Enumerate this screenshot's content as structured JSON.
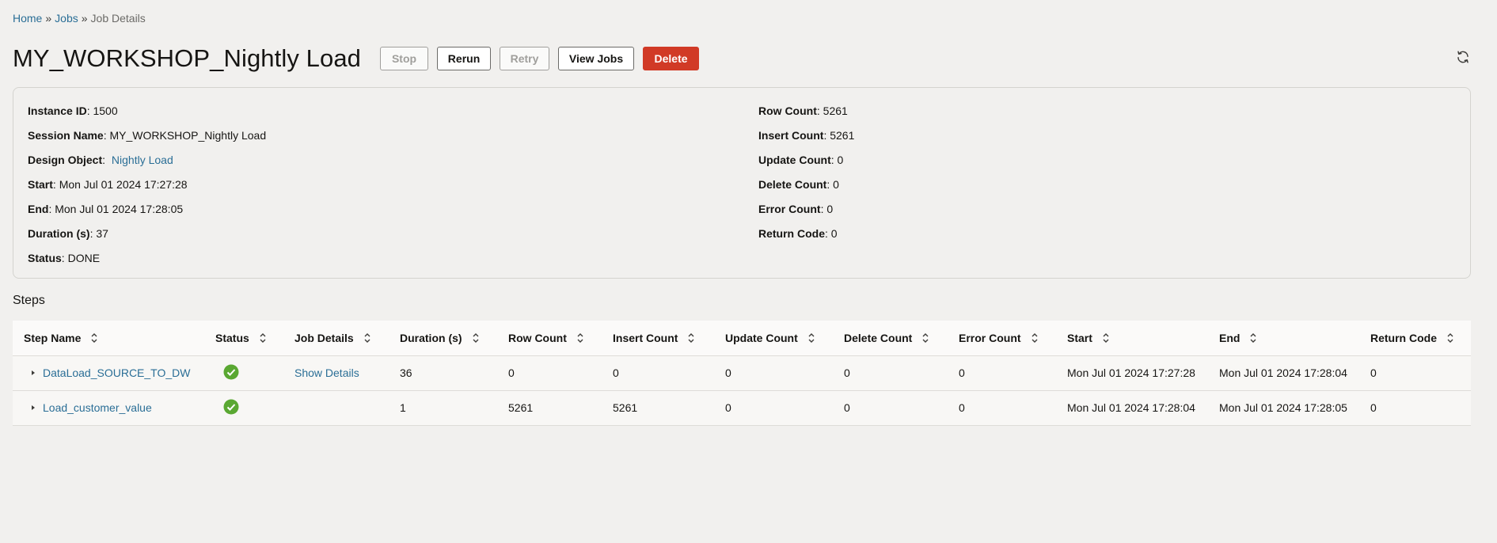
{
  "breadcrumb": {
    "home": "Home",
    "sep1": "»",
    "jobs": "Jobs",
    "sep2": "»",
    "current": "Job Details"
  },
  "title": "MY_WORKSHOP_Nightly Load",
  "toolbar": {
    "stop": "Stop",
    "rerun": "Rerun",
    "retry": "Retry",
    "view_jobs": "View Jobs",
    "delete": "Delete"
  },
  "details": {
    "instance_id": {
      "label": "Instance ID",
      "value": "1500"
    },
    "session_name": {
      "label": "Session Name",
      "value": "MY_WORKSHOP_Nightly Load"
    },
    "design_object": {
      "label": "Design Object",
      "value": "Nightly Load"
    },
    "start": {
      "label": "Start",
      "value": "Mon Jul 01 2024 17:27:28"
    },
    "end": {
      "label": "End",
      "value": "Mon Jul 01 2024 17:28:05"
    },
    "duration": {
      "label": "Duration (s)",
      "value": "37"
    },
    "status": {
      "label": "Status",
      "value": "DONE"
    },
    "row_count": {
      "label": "Row Count",
      "value": "5261"
    },
    "insert_count": {
      "label": "Insert Count",
      "value": "5261"
    },
    "update_count": {
      "label": "Update Count",
      "value": "0"
    },
    "delete_count": {
      "label": "Delete Count",
      "value": "0"
    },
    "error_count": {
      "label": "Error Count",
      "value": "0"
    },
    "return_code": {
      "label": "Return Code",
      "value": "0"
    }
  },
  "steps": {
    "heading": "Steps",
    "columns": [
      "Step Name",
      "Status",
      "Job Details",
      "Duration (s)",
      "Row Count",
      "Insert Count",
      "Update Count",
      "Delete Count",
      "Error Count",
      "Start",
      "End",
      "Return Code"
    ],
    "rows": [
      {
        "step_name": "DataLoad_SOURCE_TO_DW",
        "status": "success",
        "job_details": "Show Details",
        "duration": "36",
        "row_count": "0",
        "insert_count": "0",
        "update_count": "0",
        "delete_count": "0",
        "error_count": "0",
        "start": "Mon Jul 01 2024 17:27:28",
        "end": "Mon Jul 01 2024 17:28:04",
        "return_code": "0"
      },
      {
        "step_name": "Load_customer_value",
        "status": "success",
        "job_details": "",
        "duration": "1",
        "row_count": "5261",
        "insert_count": "5261",
        "update_count": "0",
        "delete_count": "0",
        "error_count": "0",
        "start": "Mon Jul 01 2024 17:28:04",
        "end": "Mon Jul 01 2024 17:28:05",
        "return_code": "0"
      }
    ]
  },
  "colors": {
    "link": "#2a6e96",
    "danger": "#d13a26",
    "success": "#5aa832"
  },
  "icons": {
    "refresh": "refresh-icon",
    "sort": "sort-icon",
    "expand": "caret-right-icon",
    "status_ok": "check-circle-icon"
  }
}
